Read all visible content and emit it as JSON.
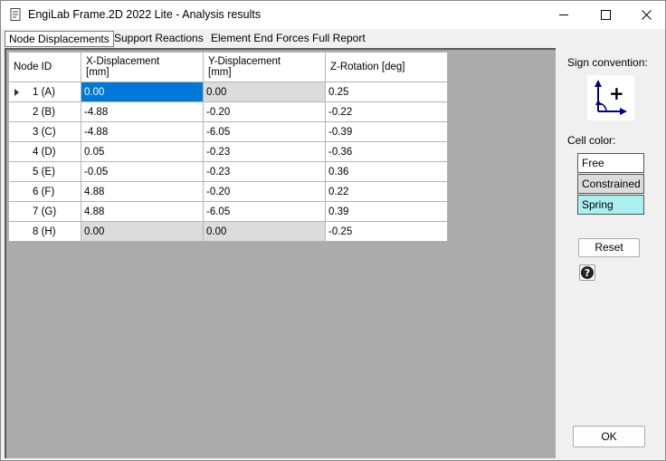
{
  "window": {
    "title": "EngiLab Frame.2D 2022 Lite - Analysis results",
    "icon": "document-icon"
  },
  "tabs": [
    {
      "label": "Node Displacements",
      "active": true
    },
    {
      "label": "Support Reactions",
      "active": false
    },
    {
      "label": "Element End Forces",
      "active": false
    },
    {
      "label": "Full Report",
      "active": false
    }
  ],
  "table": {
    "columns": [
      {
        "line1": "Node ID",
        "line2": ""
      },
      {
        "line1": "X-Displacement",
        "line2": "[mm]"
      },
      {
        "line1": "Y-Displacement",
        "line2": "[mm]"
      },
      {
        "line1": "Z-Rotation [deg]",
        "line2": ""
      }
    ],
    "rows": [
      {
        "node": "1 (A)",
        "x": "0.00",
        "y": "0.00",
        "z": "0.25"
      },
      {
        "node": "2 (B)",
        "x": "-4.88",
        "y": "-0.20",
        "z": "-0.22"
      },
      {
        "node": "3 (C)",
        "x": "-4.88",
        "y": "-6.05",
        "z": "-0.39"
      },
      {
        "node": "4 (D)",
        "x": "0.05",
        "y": "-0.23",
        "z": "-0.36"
      },
      {
        "node": "5 (E)",
        "x": "-0.05",
        "y": "-0.23",
        "z": "0.36"
      },
      {
        "node": "6 (F)",
        "x": "4.88",
        "y": "-0.20",
        "z": "0.22"
      },
      {
        "node": "7 (G)",
        "x": "4.88",
        "y": "-6.05",
        "z": "0.39"
      },
      {
        "node": "8 (H)",
        "x": "0.00",
        "y": "0.00",
        "z": "-0.25"
      }
    ]
  },
  "side": {
    "sign_convention_label": "Sign convention:",
    "plus_symbol": "+",
    "cell_color_label": "Cell color:",
    "legend": [
      {
        "label": "Free",
        "color": "#ffffff"
      },
      {
        "label": "Constrained",
        "color": "#dcdcdc"
      },
      {
        "label": "Spring",
        "color": "#aaf0f0"
      }
    ],
    "reset_label": "Reset",
    "help_symbol": "?",
    "ok_label": "OK"
  },
  "colors": {
    "selected": "#0078d7",
    "constrained": "#dcdcdc",
    "empty_area": "#ababab",
    "arrow": "#00008b"
  }
}
